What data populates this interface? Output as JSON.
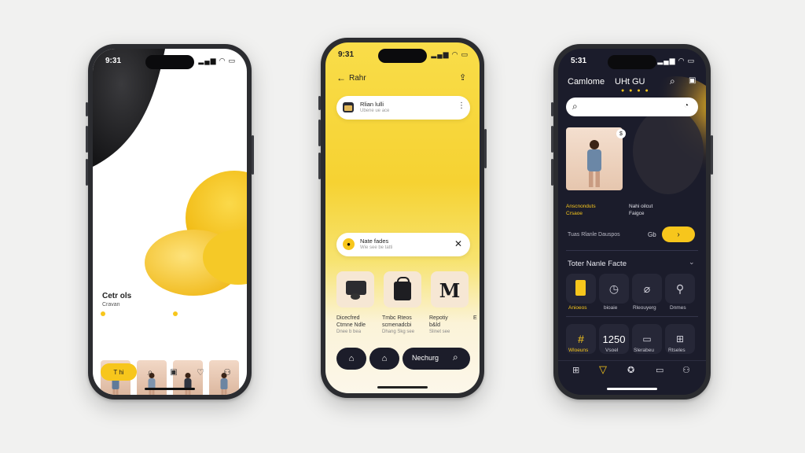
{
  "colors": {
    "accent_yellow": "#f7c61c",
    "dark_navy": "#1b1c2b",
    "white": "#ffffff"
  },
  "phone1": {
    "status_time": "9:31",
    "status_icons": "signal-wifi-battery",
    "title": "Cetr ols",
    "subtitle": "Cravan",
    "nav": {
      "active_label": "T hi",
      "icons": [
        "search-icon",
        "calendar-icon",
        "heart-icon",
        "profile-icon"
      ]
    }
  },
  "phone2": {
    "status_time": "9:31",
    "header_title": "Rahr",
    "card1": {
      "title": "Rlian lulli",
      "subtitle": "Ubene ue ace"
    },
    "card2": {
      "title": "Nate fades",
      "subtitle": "Wie see be tatti"
    },
    "products": [
      {
        "name": "Dicecfred",
        "detail": "Ctmne Ndle",
        "sub": "Dnee b bea"
      },
      {
        "name": "Tmbc Rteos",
        "detail": "scmenadcbi",
        "sub": "Dhang Skg see"
      },
      {
        "name": "Repotiy",
        "detail": "b&ld",
        "sub": "Slinet see"
      }
    ],
    "partial_product": "E",
    "nav": {
      "search_label": "Nechurg"
    }
  },
  "phone3": {
    "status_time": "5:31",
    "title": "Camlome",
    "title2": "UHt GU",
    "search_placeholder": "",
    "product_tags": [
      "Anscnonduts Crsaoe",
      "Nahi oilcut Faigce"
    ],
    "promo_text": "Tuas Rlanle Dauspos",
    "promo_icon_label": "Gb",
    "section_title": "Toter Nanle Facte",
    "tiles_row1": [
      "Anioeos",
      "bioaie",
      "Rleouyerg",
      "Dnmes"
    ],
    "tiles_row2_value": "1250",
    "tiles_row2": [
      "Wloeuns",
      "Vsoel",
      "Slerabeu",
      "Rtseles"
    ]
  }
}
